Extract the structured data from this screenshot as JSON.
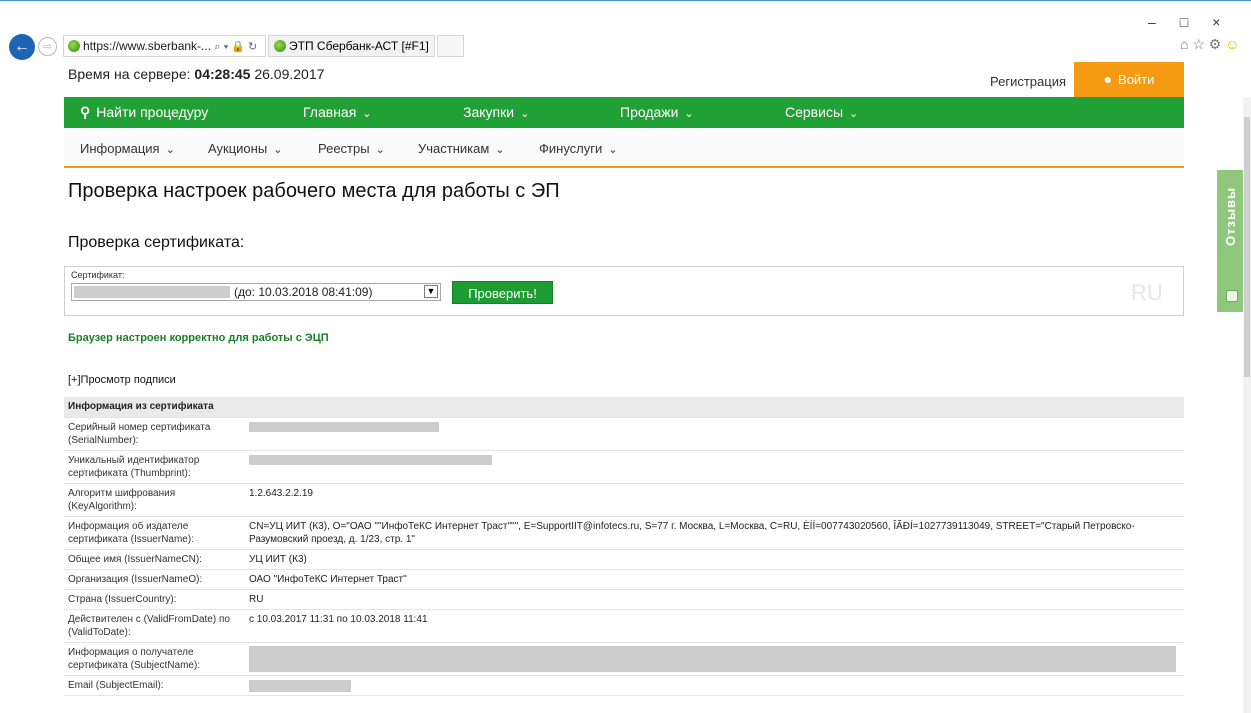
{
  "browser": {
    "url": "https://www.sberbank-...",
    "address_controls": "⌕ ▾ 🔒 ↻",
    "tab_title": "ЭТП Сбербанк-АСТ [#F1]",
    "tab_close": "×",
    "back_glyph": "←",
    "forward_glyph": "⇨",
    "window_controls": "–□×",
    "tool_icons": "⌂ ☆ ⚙",
    "smiley": "☺"
  },
  "header": {
    "server_time_label": "Время на сервере:",
    "server_time_value": "04:28:45",
    "server_date": "26.09.2017",
    "register_label": "Регистрация",
    "login_label": "Войти"
  },
  "main_nav": {
    "search": "Найти процедуру",
    "home": "Главная",
    "purchases": "Закупки",
    "sales": "Продажи",
    "services": "Сервисы"
  },
  "sub_nav": {
    "info": "Информация",
    "auctions": "Аукционы",
    "registries": "Реестры",
    "participants": "Участникам",
    "finservices": "Финуслуги"
  },
  "page": {
    "title": "Проверка настроек рабочего места для работы с ЭП",
    "section_title": "Проверка сертификата:",
    "cert_label": "Сертификат:",
    "cert_expiry": "(до: 10.03.2018 08:41:09)",
    "verify_button": "Проверить!",
    "lang_watermark": "RU",
    "status_message": "Браузер настроен корректно для работы с ЭЦП",
    "view_signature": "[+]Просмотр подписи"
  },
  "cert_table": {
    "header": "Информация из сертификата",
    "rows": [
      {
        "label": "Серийный номер сертификата (SerialNumber):",
        "value": ""
      },
      {
        "label": "Уникальный идентификатор сертификата (Thumbprint):",
        "value": ""
      },
      {
        "label": "Алгоритм шифрования (KeyAlgorithm):",
        "value": "1.2.643.2.2.19"
      },
      {
        "label": "Информация об издателе сертификата (IssuerName):",
        "value": "CN=УЦ ИИТ (К3), O=\"ОАО \"\"ИнфоТеКС Интернет Траст\"\"\", E=SupportIIT@infotecs.ru, S=77 г. Москва, L=Москва, C=RU, ÈÍÍ=007743020560, ÎÃÐÍ=1027739113049, STREET=\"Старый Петровско-Разумовский проезд, д. 1/23, стр. 1\""
      },
      {
        "label": "Общее имя (IssuerNameCN):",
        "value": "УЦ ИИТ (К3)"
      },
      {
        "label": "Организация (IssuerNameO):",
        "value": "ОАО \"ИнфоТеКС Интернет Траст\""
      },
      {
        "label": "Страна (IssuerCountry):",
        "value": "RU"
      },
      {
        "label": "Действителен с (ValidFromDate) по (ValidToDate):",
        "value": "с 10.03.2017 11:31 по 10.03.2018 11:41"
      },
      {
        "label": "Информация о получателе сертификата (SubjectName):",
        "value": ""
      },
      {
        "label": "Email (SubjectEmail):",
        "value": ""
      }
    ]
  },
  "feedback": {
    "label": "Отзывы"
  },
  "colors": {
    "green_nav": "#21a035",
    "orange_accent": "#f49a13",
    "status_green": "#1a7f22",
    "feedback_green": "#8fc87d"
  }
}
